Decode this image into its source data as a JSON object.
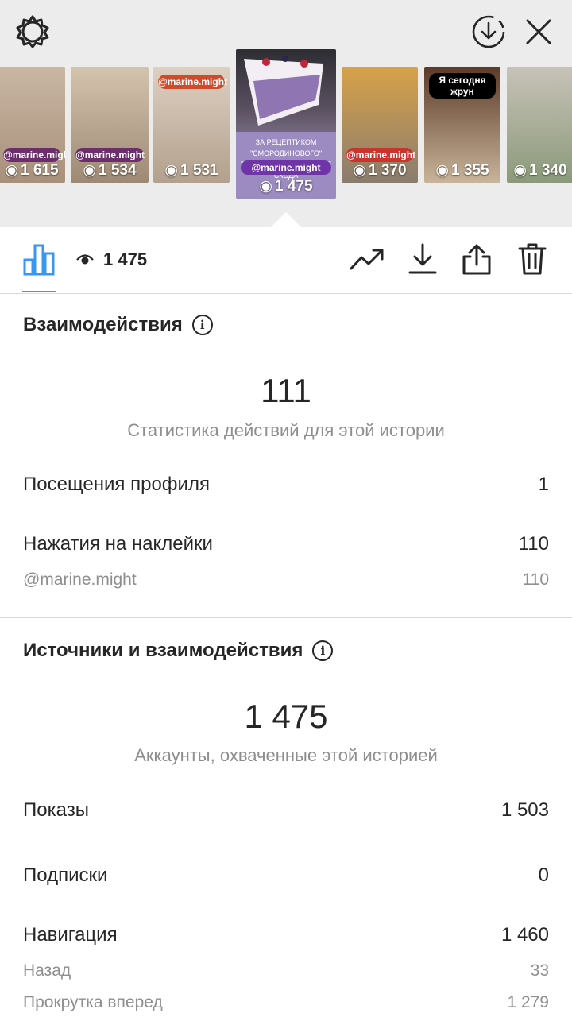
{
  "header": {
    "stories": [
      {
        "views": "1 615",
        "handle": "@marine.might",
        "colors": [
          "#c9b7a4",
          "#a8907a"
        ]
      },
      {
        "views": "1 534",
        "handle": "@marine.might",
        "colors": [
          "#d4c3ad",
          "#9e8a74"
        ]
      },
      {
        "views": "1 531",
        "handle": "@marine.might",
        "colors": [
          "#ddd0c2",
          "#b3a08d"
        ]
      },
      {
        "views": "1 475",
        "handle": "@marine.might",
        "caption": "ЗА РЕЦЕПТИКОМ \"СМОРОДИНОВОГО\" ТОРТИКА НА СКОВОРОДЕ СКОДА",
        "colors": [
          "#2d2d33",
          "#bdb2d8"
        ]
      },
      {
        "views": "1 370",
        "handle": "@marine.might",
        "colors": [
          "#d7a24a",
          "#8a7c6e"
        ]
      },
      {
        "views": "1 355",
        "handle": "",
        "label": "Я сегодня жрун",
        "colors": [
          "#5b3a28",
          "#c9b49a"
        ]
      },
      {
        "views": "1 340",
        "handle": "",
        "colors": [
          "#c7c2b8",
          "#8b9a7a"
        ]
      }
    ]
  },
  "toolbar": {
    "views": "1 475"
  },
  "interactions": {
    "title": "Взаимодействия",
    "total": "111",
    "subtitle": "Статистика действий для этой истории",
    "profile_visits_label": "Посещения профиля",
    "profile_visits_value": "1",
    "sticker_taps_label": "Нажатия на наклейки",
    "sticker_taps_value": "110",
    "sticker_handle_label": "@marine.might",
    "sticker_handle_value": "110"
  },
  "discovery": {
    "title": "Источники и взаимодействия",
    "total": "1 475",
    "subtitle": "Аккаунты, охваченные этой историей",
    "impressions_label": "Показы",
    "impressions_value": "1 503",
    "follows_label": "Подписки",
    "follows_value": "0",
    "navigation_label": "Навигация",
    "navigation_value": "1 460",
    "back_label": "Назад",
    "back_value": "33",
    "forward_label": "Прокрутка вперед",
    "forward_value": "1 279"
  },
  "colors": {
    "accent": "#3897f0",
    "header_bg": "#ececec",
    "muted": "#8e8e8e"
  },
  "icons": [
    "settings-gear-icon",
    "download-circle-icon",
    "close-icon",
    "bar-chart-icon",
    "eye-icon",
    "trend-icon",
    "download-icon",
    "share-icon",
    "trash-icon",
    "info-icon"
  ]
}
